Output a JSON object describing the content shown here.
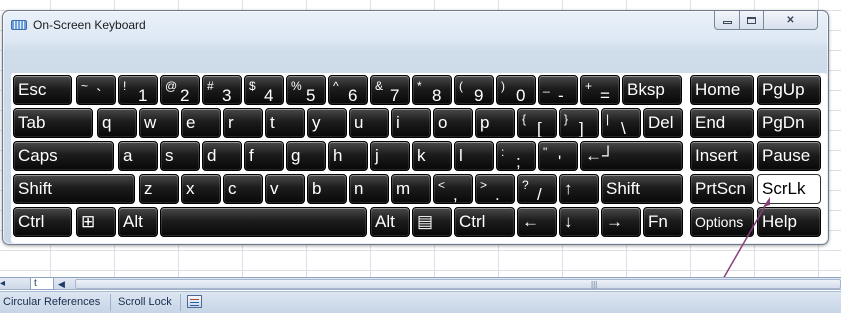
{
  "window": {
    "title": "On-Screen Keyboard",
    "close_label": "✕"
  },
  "keyboard": {
    "rows": [
      [
        {
          "label": "Esc",
          "type": "text"
        },
        {
          "shift": "~",
          "base": "`",
          "type": "sym"
        },
        {
          "shift": "!",
          "base": "1",
          "type": "sym"
        },
        {
          "shift": "@",
          "base": "2",
          "type": "sym"
        },
        {
          "shift": "#",
          "base": "3",
          "type": "sym"
        },
        {
          "shift": "$",
          "base": "4",
          "type": "sym"
        },
        {
          "shift": "%",
          "base": "5",
          "type": "sym"
        },
        {
          "shift": "^",
          "base": "6",
          "type": "sym"
        },
        {
          "shift": "&",
          "base": "7",
          "type": "sym"
        },
        {
          "shift": "*",
          "base": "8",
          "type": "sym"
        },
        {
          "shift": "(",
          "base": "9",
          "type": "sym"
        },
        {
          "shift": ")",
          "base": "0",
          "type": "sym"
        },
        {
          "shift": "_",
          "base": "-",
          "type": "sym"
        },
        {
          "shift": "+",
          "base": "=",
          "type": "sym"
        },
        {
          "label": "Bksp",
          "type": "text"
        },
        {
          "label": "Home",
          "type": "text"
        },
        {
          "label": "PgUp",
          "type": "text"
        }
      ],
      [
        {
          "label": "Tab",
          "type": "text"
        },
        {
          "label": "q",
          "type": "text"
        },
        {
          "label": "w",
          "type": "text"
        },
        {
          "label": "e",
          "type": "text"
        },
        {
          "label": "r",
          "type": "text"
        },
        {
          "label": "t",
          "type": "text"
        },
        {
          "label": "y",
          "type": "text"
        },
        {
          "label": "u",
          "type": "text"
        },
        {
          "label": "i",
          "type": "text"
        },
        {
          "label": "o",
          "type": "text"
        },
        {
          "label": "p",
          "type": "text"
        },
        {
          "shift": "{",
          "base": "[",
          "type": "sym"
        },
        {
          "shift": "}",
          "base": "]",
          "type": "sym"
        },
        {
          "shift": "|",
          "base": "\\",
          "type": "sym"
        },
        {
          "label": "Del",
          "type": "text"
        },
        {
          "label": "End",
          "type": "text"
        },
        {
          "label": "PgDn",
          "type": "text"
        }
      ],
      [
        {
          "label": "Caps",
          "type": "text"
        },
        {
          "label": "a",
          "type": "text"
        },
        {
          "label": "s",
          "type": "text"
        },
        {
          "label": "d",
          "type": "text"
        },
        {
          "label": "f",
          "type": "text"
        },
        {
          "label": "g",
          "type": "text"
        },
        {
          "label": "h",
          "type": "text"
        },
        {
          "label": "j",
          "type": "text"
        },
        {
          "label": "k",
          "type": "text"
        },
        {
          "label": "l",
          "type": "text"
        },
        {
          "shift": ":",
          "base": ";",
          "type": "sym"
        },
        {
          "shift": "\"",
          "base": "'",
          "type": "sym"
        },
        {
          "label": "←┘",
          "type": "text"
        },
        {
          "label": "Insert",
          "type": "text"
        },
        {
          "label": "Pause",
          "type": "text"
        }
      ],
      [
        {
          "label": "Shift",
          "type": "text"
        },
        {
          "label": "z",
          "type": "text"
        },
        {
          "label": "x",
          "type": "text"
        },
        {
          "label": "c",
          "type": "text"
        },
        {
          "label": "v",
          "type": "text"
        },
        {
          "label": "b",
          "type": "text"
        },
        {
          "label": "n",
          "type": "text"
        },
        {
          "label": "m",
          "type": "text"
        },
        {
          "shift": "<",
          "base": ",",
          "type": "sym"
        },
        {
          "shift": ">",
          "base": ".",
          "type": "sym"
        },
        {
          "shift": "?",
          "base": "/",
          "type": "sym"
        },
        {
          "label": "↑",
          "type": "text"
        },
        {
          "label": "Shift",
          "type": "text"
        },
        {
          "label": "PrtScn",
          "type": "text"
        },
        {
          "label": "ScrLk",
          "type": "text",
          "active": true
        }
      ],
      [
        {
          "label": "Ctrl",
          "type": "text"
        },
        {
          "label": "⊞",
          "type": "text",
          "icon": "windows-icon"
        },
        {
          "label": "Alt",
          "type": "text"
        },
        {
          "label": "",
          "type": "text",
          "icon": "space"
        },
        {
          "label": "Alt",
          "type": "text"
        },
        {
          "label": "▤",
          "type": "text",
          "icon": "menu-icon"
        },
        {
          "label": "Ctrl",
          "type": "text"
        },
        {
          "label": "←",
          "type": "text"
        },
        {
          "label": "↓",
          "type": "text"
        },
        {
          "label": "→",
          "type": "text"
        },
        {
          "label": "Fn",
          "type": "text"
        },
        {
          "label": "Options",
          "type": "text"
        },
        {
          "label": "Help",
          "type": "text"
        }
      ]
    ]
  },
  "sheet_tabs": {
    "nav_label": "◂",
    "tab_label": "t",
    "scroll_left": "◀"
  },
  "status_bar": {
    "circular_references": "Circular References",
    "scroll_lock": "Scroll Lock"
  },
  "colors": {
    "key_face": "#1c1c1c",
    "key_active": "#ffffff",
    "arrow": "#8a3f7a"
  }
}
